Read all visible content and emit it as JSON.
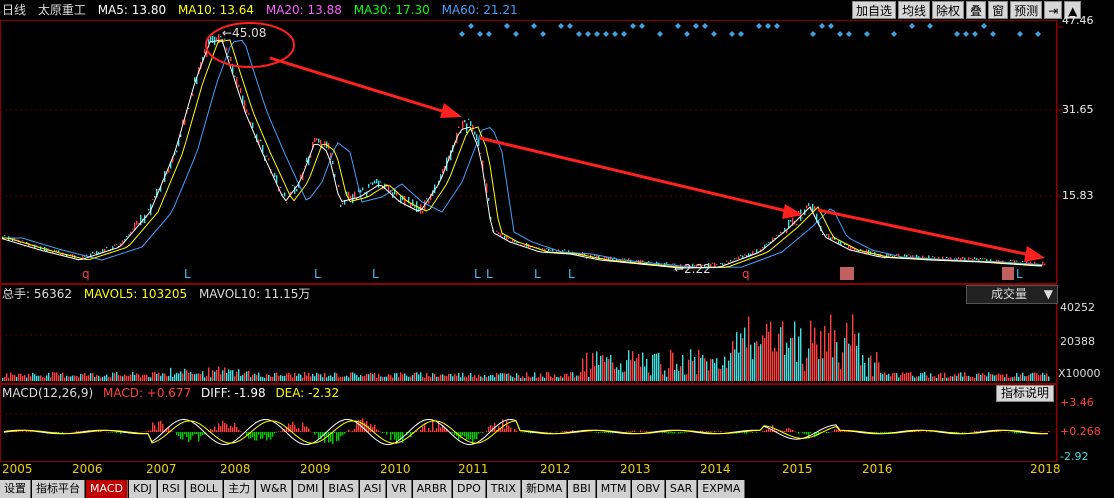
{
  "header": {
    "period": "日线",
    "name": "太原重工",
    "ma5": "MA5: 13.80",
    "ma10": "MA10: 13.64",
    "ma20": "MA20: 13.88",
    "ma30": "MA30: 17.30",
    "ma60": "MA60: 21.21"
  },
  "toolbar": [
    "加自选",
    "均线",
    "除权",
    "叠",
    "窗",
    "预测"
  ],
  "price_axis": [
    "47.46",
    "31.65",
    "15.83"
  ],
  "annotations": {
    "high": "45.08",
    "low": "2.22",
    "markers": [
      "q",
      "L",
      "L",
      "L",
      "L",
      "L",
      "L",
      "L",
      "q",
      "L"
    ]
  },
  "volume": {
    "total": "总手: 56362",
    "mavol5": "MAVOL5: 103205",
    "mavol10": "MAVOL10: 11.15万",
    "dropdown": "成交量",
    "axis": [
      "40252",
      "20388",
      "X10000"
    ]
  },
  "macd": {
    "title": "MACD(12,26,9)",
    "macd": "MACD: +0.677",
    "diff": "DIFF: -1.98",
    "dea": "DEA: -2.32",
    "help": "指标说明",
    "axis": [
      "+3.46",
      "+0.268",
      "-2.92"
    ]
  },
  "years": [
    "2005",
    "2006",
    "2007",
    "2008",
    "2009",
    "2010",
    "2011",
    "2012",
    "2013",
    "2014",
    "2015",
    "2016",
    "2018"
  ],
  "tabs": [
    "设置",
    "指标平台",
    "MACD",
    "KDJ",
    "RSI",
    "BOLL",
    "主力",
    "W&R",
    "DMI",
    "BIAS",
    "ASI",
    "VR",
    "ARBR",
    "DPO",
    "TRIX",
    "新DMA",
    "BBI",
    "MTM",
    "OBV",
    "SAR",
    "EXPMA"
  ],
  "active_tab": "MACD",
  "colors": {
    "up": "#ff4040",
    "down": "#40e0e0",
    "ma5": "#ffffff",
    "ma10": "#ffff00",
    "ma20": "#ff60ff",
    "ma30": "#00ff00",
    "ma60": "#40a0ff",
    "arrow": "#ff2020"
  }
}
